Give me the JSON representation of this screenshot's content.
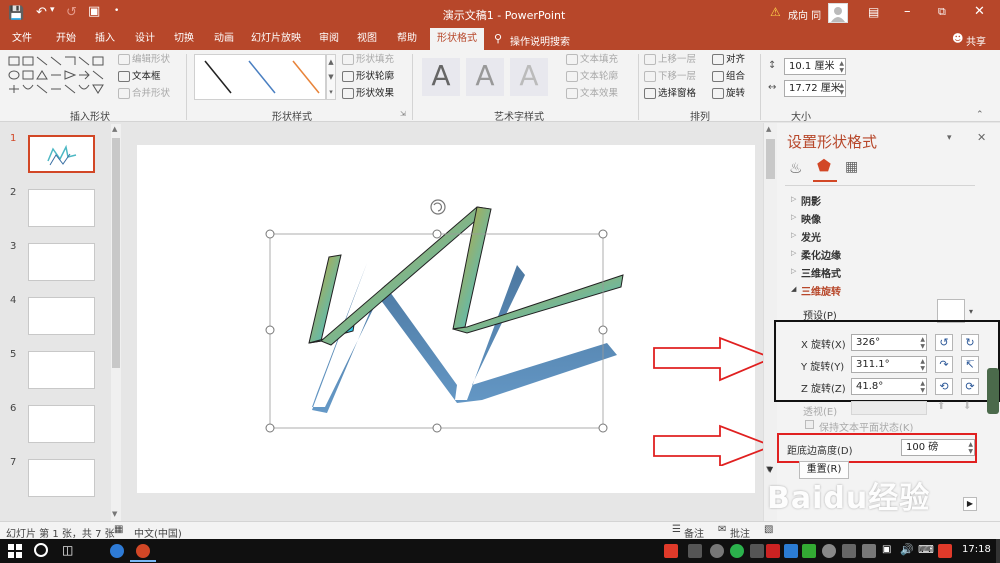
{
  "titlebar": {
    "title": "演示文稿1 - PowerPoint",
    "user": "成向 同",
    "warning_icon": "warning-icon"
  },
  "tabs": [
    "文件",
    "开始",
    "插入",
    "设计",
    "切换",
    "动画",
    "幻灯片放映",
    "审阅",
    "视图",
    "帮助",
    "形状格式"
  ],
  "tell_me": "操作说明搜索",
  "share": "共享",
  "ribbon": {
    "insert_shapes": {
      "label": "插入形状",
      "edit_shape": "编辑形状",
      "text_box": "文本框",
      "merge_shapes": "合并形状"
    },
    "shape_styles": {
      "label": "形状样式",
      "fill": "形状填充",
      "outline": "形状轮廓",
      "effects": "形状效果"
    },
    "wordart": {
      "label": "艺术字样式",
      "sample": "A",
      "text_fill": "文本填充",
      "text_outline": "文本轮廓",
      "text_effects": "文本效果"
    },
    "arrange": {
      "label": "排列",
      "bring_forward": "上移一层",
      "send_backward": "下移一层",
      "selection_pane": "选择窗格",
      "align": "对齐",
      "group": "组合",
      "rotate": "旋转"
    },
    "size": {
      "label": "大小",
      "height": "10.1 厘米",
      "width": "17.72 厘米"
    }
  },
  "slides": {
    "numbers": [
      "1",
      "2",
      "3",
      "4",
      "5",
      "6",
      "7"
    ],
    "selected": 1
  },
  "format_pane": {
    "title": "设置形状格式",
    "sections": [
      "阴影",
      "映像",
      "发光",
      "柔化边缘",
      "三维格式",
      "三维旋转"
    ],
    "expanded_section": "三维旋转",
    "preset_label": "预设(P)",
    "x_label": "X 旋转(X)",
    "x_value": "326°",
    "y_label": "Y 旋转(Y)",
    "y_value": "311.1°",
    "z_label": "Z 旋转(Z)",
    "z_value": "41.8°",
    "perspective_label": "透视(E)",
    "keep_flat": "保持文本平面状态(K)",
    "distance_label": "距底边高度(D)",
    "distance_value": "100 磅",
    "reset": "重置(R)"
  },
  "statusbar": {
    "slide_info": "幻灯片 第 1 张，共 7 张",
    "language": "中文(中国)",
    "notes": "备注",
    "comments": "批注"
  },
  "taskbar": {
    "time": "17:18"
  },
  "watermark": "Baidu经验",
  "colors": {
    "accent": "#b7472a",
    "highlight_box": "#e02020",
    "dark_box": "#111111"
  }
}
